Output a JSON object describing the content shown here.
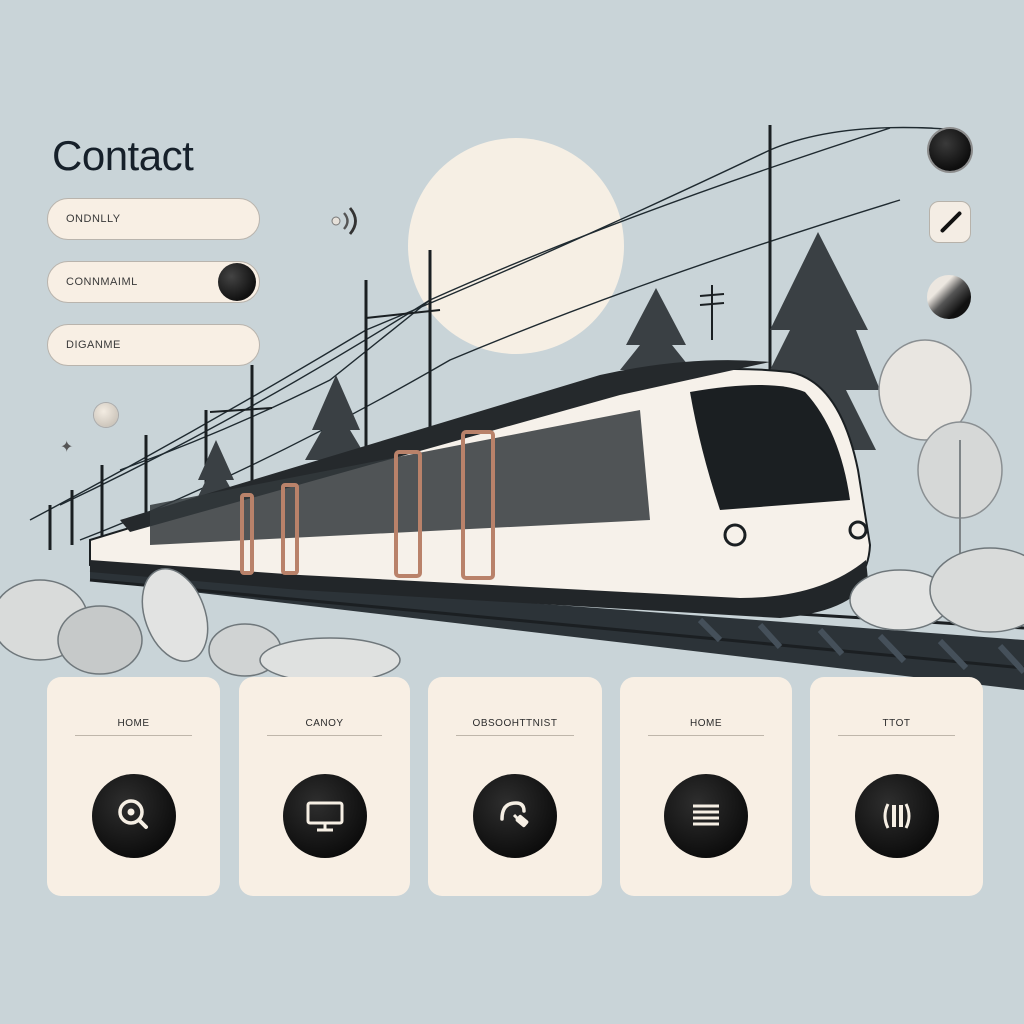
{
  "page": {
    "title": "Contact"
  },
  "form": {
    "fields": [
      {
        "label": "ONDNLLY"
      },
      {
        "label": "CONNMAIML"
      },
      {
        "label": "DIGANME"
      }
    ]
  },
  "cards": [
    {
      "label": "HOME",
      "icon": "search-icon"
    },
    {
      "label": "CANOY",
      "icon": "monitor-icon"
    },
    {
      "label": "OBSOOHTTNIST",
      "icon": "plug-icon"
    },
    {
      "label": "HOME",
      "icon": "menu-icon"
    },
    {
      "label": "TTOT",
      "icon": "pause-icon"
    }
  ],
  "side_buttons": [
    "dark-dot-icon",
    "pencil-icon",
    "half-circle-icon"
  ],
  "colors": {
    "background": "#c9d4d8",
    "card": "#f8efe4",
    "dark": "#0e0e0e",
    "train_door": "#b9826a"
  }
}
